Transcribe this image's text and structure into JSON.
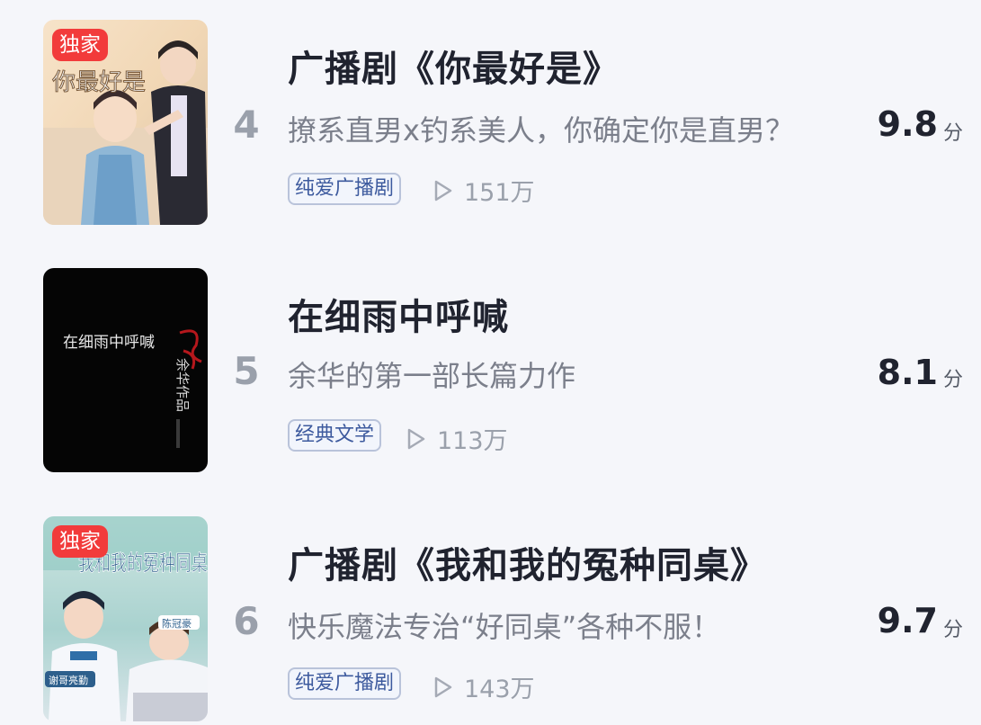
{
  "items": [
    {
      "rank": "4",
      "title": "广播剧《你最好是》",
      "description": "撩系直男x钓系美人，你确定你是直男？",
      "tag": "纯爱广播剧",
      "plays": "151万",
      "score": "9.8",
      "score_unit": "分",
      "badge": "独家",
      "cover_text": "你最好是"
    },
    {
      "rank": "5",
      "title": "在细雨中呼喊",
      "description": "余华的第一部长篇力作",
      "tag": "经典文学",
      "plays": "113万",
      "score": "8.1",
      "score_unit": "分",
      "cover_text": "在细雨中呼喊",
      "cover_author": "余华作品"
    },
    {
      "rank": "6",
      "title": "广播剧《我和我的冤种同桌》",
      "description": "快乐魔法专治“好同桌”各种不服！",
      "tag": "纯爱广播剧",
      "plays": "143万",
      "score": "9.7",
      "score_unit": "分",
      "badge": "独家",
      "cover_text": "我和我的冤种同桌",
      "cover_name_1": "陈冠豪",
      "cover_name_2": "谢哥亮勤"
    }
  ],
  "icons": {
    "play": "play-outline-icon"
  },
  "colors": {
    "badge": "#f23b3b",
    "tag_text": "#3d5a9e",
    "tag_border": "#b9c3da"
  }
}
